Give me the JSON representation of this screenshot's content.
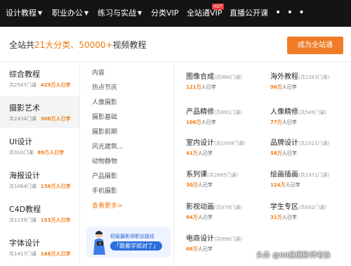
{
  "topnav": {
    "items": [
      {
        "label": "设计教程",
        "chevron": true
      },
      {
        "label": "职业办公",
        "chevron": true
      },
      {
        "label": "练习与实战",
        "chevron": true
      },
      {
        "label": "分类VIP",
        "chevron": false
      },
      {
        "label": "全站通VIP",
        "chevron": false
      },
      {
        "label": "直播公开课",
        "chevron": false
      }
    ],
    "hot_badge": "HOT",
    "more": "• • •"
  },
  "banner": {
    "prefix": "全站共",
    "categories": "21大分类",
    "sep": "、",
    "videos": "50000+",
    "suffix": "视频教程",
    "join_button": "成为全站通"
  },
  "categories": [
    {
      "name": "综合教程",
      "courses": "共2547门课",
      "learners": "429万人已学"
    },
    {
      "name": "摄影艺术",
      "courses": "共2434门课",
      "learners": "306万人已学"
    },
    {
      "name": "UI设计",
      "courses": "共910门课",
      "learners": "89万人已学"
    },
    {
      "name": "海报设计",
      "courses": "共1064门课",
      "learners": "159万人已学"
    },
    {
      "name": "C4D教程",
      "courses": "共1139门课",
      "learners": "153万人已学"
    },
    {
      "name": "字体设计",
      "courses": "共1417门课",
      "learners": "168万人已学"
    }
  ],
  "subcategories": [
    "内容",
    "热点节庆",
    "人像摄影",
    "摄影基础",
    "摄影前期",
    "风光建筑...",
    "动物静物",
    "产品摄影",
    "手机摄影"
  ],
  "see_more": "查看更多>",
  "promo": {
    "line1": "初级摄影师职业路径",
    "line2": "「跟着学就对了」"
  },
  "courses": [
    {
      "name": "图像合成",
      "count": "(共988门课)",
      "num": "121万",
      "unit": "人已学"
    },
    {
      "name": "海外教程",
      "count": "(共1263门课)",
      "num": "96万",
      "unit": "人已学"
    },
    {
      "name": "产品精修",
      "count": "(共691门课)",
      "num": "106万",
      "unit": "人已学"
    },
    {
      "name": "人像精修",
      "count": "(共549门课)",
      "num": "77万",
      "unit": "人已学"
    },
    {
      "name": "室内设计",
      "count": "(共1099门课)",
      "num": "41万",
      "unit": "人已学"
    },
    {
      "name": "品牌设计",
      "count": "(共1011门课)",
      "num": "58万",
      "unit": "人已学"
    },
    {
      "name": "系列课",
      "count": "(共2685门课)",
      "num": "30万",
      "unit": "人已学"
    },
    {
      "name": "绘画插画",
      "count": "(共1971门课)",
      "num": "124万",
      "unit": "人已学"
    },
    {
      "name": "影视动画",
      "count": "(共979门课)",
      "num": "84万",
      "unit": "人已学"
    },
    {
      "name": "学生专区",
      "count": "(共692门课)",
      "num": "31万",
      "unit": "人已学"
    },
    {
      "name": "电商设计",
      "count": "(共996门课)",
      "num": "66万",
      "unit": "人已学"
    }
  ],
  "watermark": "头条 @90后摄影师老徐",
  "colors": {
    "accent": "#f07b14",
    "button": "#ef7c27",
    "nav_bg": "#141414",
    "promo_blue": "#2b6fe0"
  }
}
